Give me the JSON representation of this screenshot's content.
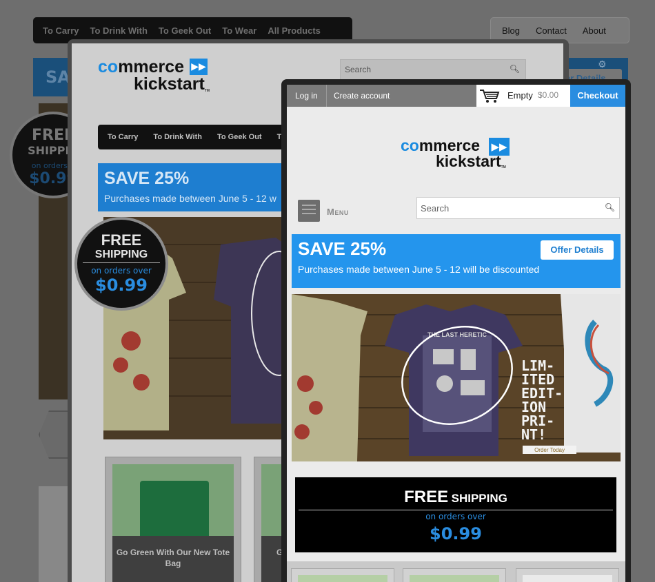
{
  "desktop": {
    "main_nav": [
      "To Carry",
      "To Drink With",
      "To Geek Out",
      "To Wear",
      "All Products"
    ],
    "secondary_nav": [
      "Blog",
      "Contact",
      "About"
    ],
    "banner_title": "SAV",
    "offer_button": "er Details",
    "badge": {
      "line1": "FREE",
      "line2": "SHIPPIN",
      "line3": "on orders o",
      "line4": "$0.99"
    }
  },
  "tablet": {
    "logo": {
      "word1_prefix": "co",
      "word1_rest": "mmerce",
      "word2": "kickstart",
      "tm": "TM"
    },
    "search_placeholder": "Search",
    "nav": [
      "To Carry",
      "To Drink With",
      "To Geek Out",
      "To"
    ],
    "banner": {
      "title": "SAVE 25%",
      "subtitle": "Purchases made between June 5 - 12 w"
    },
    "badge": {
      "line1": "FREE",
      "line2": "SHIPPING",
      "line3": "on orders over",
      "line4": "$0.99"
    },
    "cards": [
      {
        "caption": "Go Green With Our New Tote Bag"
      },
      {
        "caption": "G"
      }
    ]
  },
  "phone": {
    "login": "Log in",
    "create_account": "Create account",
    "cart": {
      "status": "Empty",
      "amount": "$0.00"
    },
    "checkout": "Checkout",
    "logo": {
      "word1_prefix": "co",
      "word1_rest": "mmerce",
      "word2": "kickstart",
      "tm": "TM"
    },
    "menu_label": "Menu",
    "search_placeholder": "Search",
    "banner": {
      "title": "SAVE 25%",
      "subtitle": "Purchases made between June 5 - 12 will be discounted",
      "offer_button": "Offer Details"
    },
    "hero": {
      "shirt_text": "THE LAST HERETIC",
      "promo_lines": [
        "LIM-",
        "ITED",
        "EDIT-",
        "ION",
        "PRI-",
        "NT!"
      ],
      "order_button": "Order Today"
    },
    "shipping": {
      "big": "FREE",
      "small": "SHIPPING",
      "line3": "on orders over",
      "price": "$0.99"
    }
  },
  "colors": {
    "accent": "#2495ed",
    "nav_bg": "#111111",
    "shadow_overlay": "#6e6e6e"
  }
}
